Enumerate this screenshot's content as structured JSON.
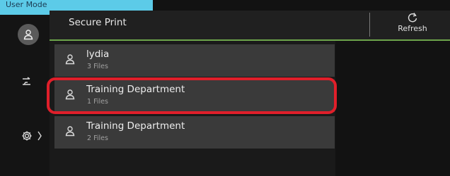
{
  "status_bar": {
    "mode_label": "User Mode"
  },
  "header": {
    "title": "Secure Print",
    "refresh_label": "Refresh"
  },
  "colors": {
    "accent_green": "#6da54b",
    "highlight_red": "#e01f2a",
    "mode_bar": "#5ccbe8"
  },
  "users": [
    {
      "name": "lydia",
      "files": "3 Files",
      "icon": "user-icon"
    },
    {
      "name": "Training Department",
      "files": "1 Files",
      "icon": "user-icon",
      "highlighted": true
    },
    {
      "name": "Training Department",
      "files": "2 Files",
      "icon": "user-icon"
    }
  ],
  "left_rail": {
    "icons": [
      "user-icon",
      "log-out-icon",
      "gear-icon",
      "chevron-right-icon"
    ]
  }
}
